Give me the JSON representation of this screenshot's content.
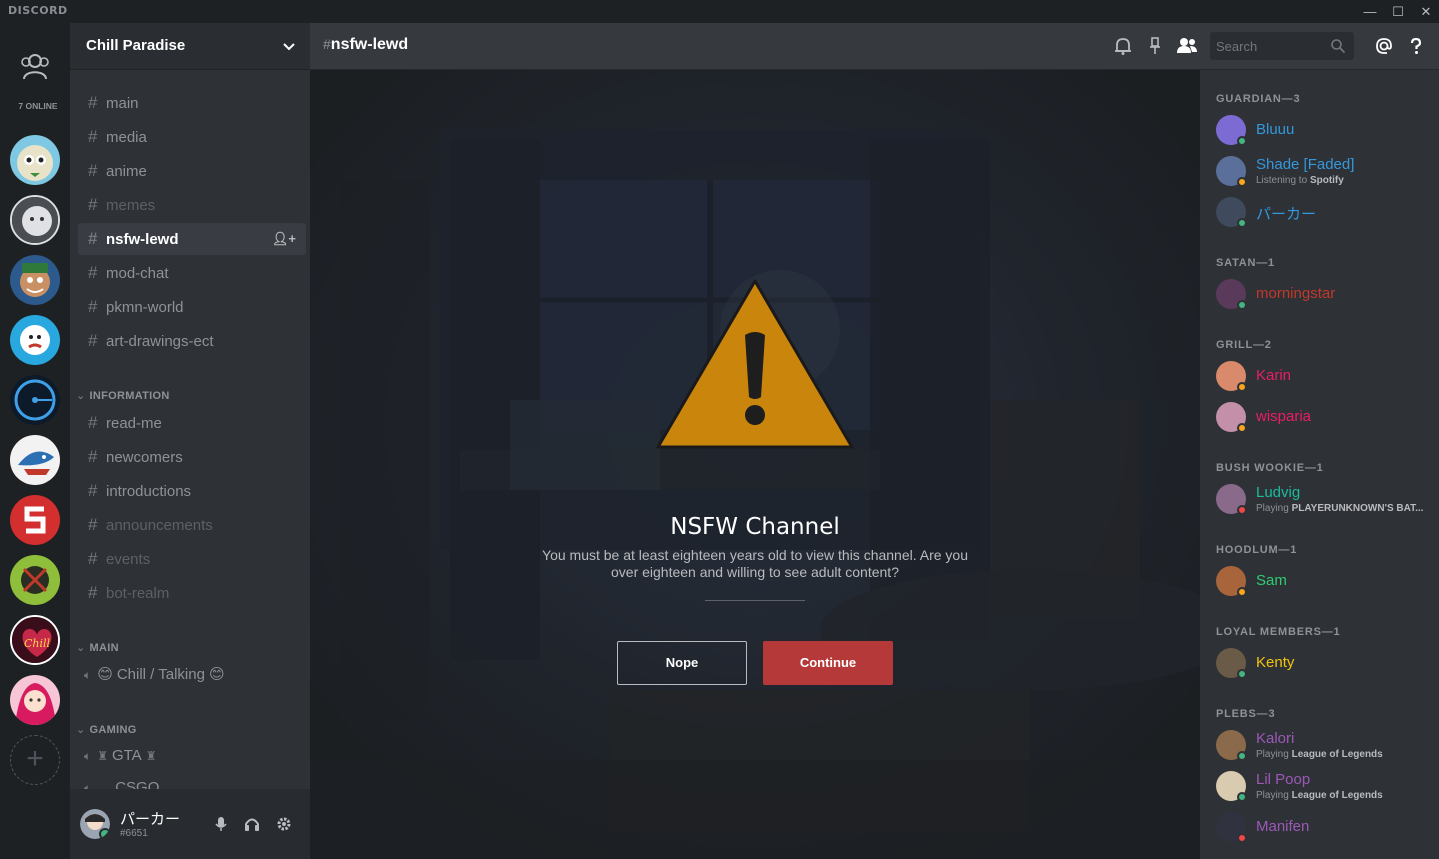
{
  "app": {
    "logo": "DISCORD",
    "window_controls": [
      "—",
      "☐",
      "✕"
    ]
  },
  "guild_rail": {
    "online_count": "7 ONLINE",
    "add_label": "+"
  },
  "sidebar": {
    "server_name": "Chill Paradise",
    "channels_top": [
      {
        "name": "main",
        "state": "normal"
      },
      {
        "name": "media",
        "state": "normal"
      },
      {
        "name": "anime",
        "state": "normal"
      },
      {
        "name": "memes",
        "state": "dim"
      },
      {
        "name": "nsfw-lewd",
        "state": "active"
      },
      {
        "name": "mod-chat",
        "state": "normal"
      },
      {
        "name": "pkmn-world",
        "state": "normal"
      },
      {
        "name": "art-drawings-ect",
        "state": "normal"
      }
    ],
    "category_information": "INFORMATION",
    "channels_info": [
      {
        "name": "read-me",
        "state": "normal"
      },
      {
        "name": "newcomers",
        "state": "normal"
      },
      {
        "name": "introductions",
        "state": "normal"
      },
      {
        "name": "announcements",
        "state": "dim"
      },
      {
        "name": "events",
        "state": "dim"
      },
      {
        "name": "bot-realm",
        "state": "dim"
      }
    ],
    "category_main": "MAIN",
    "voice_main": "Chill / Talking",
    "category_gaming": "GAMING",
    "voice_gaming": "GTA",
    "voice_gaming_cut": "CSGO",
    "user": {
      "name": "パーカー",
      "tag": "#6651"
    }
  },
  "topbar": {
    "channel": "nsfw-lewd",
    "search_placeholder": "Search"
  },
  "gate": {
    "title": "NSFW Channel",
    "description": "You must be at least eighteen years old to view this channel. Are you over eighteen and willing to see adult content?",
    "nope": "Nope",
    "continue": "Continue"
  },
  "members": {
    "categories": [
      {
        "label": "GUARDIAN—3"
      },
      {
        "label": "SATAN—1"
      },
      {
        "label": "GRILL—2"
      },
      {
        "label": "BUSH WOOKIE—1"
      },
      {
        "label": "HOODLUM—1"
      },
      {
        "label": "LOYAL MEMBERS—1"
      },
      {
        "label": "PLEBS—3"
      }
    ],
    "list": [
      {
        "name": "Bluuu",
        "color": "#3498db",
        "status": "online",
        "activity_prefix": "",
        "activity": ""
      },
      {
        "name": "Shade [Faded]",
        "color": "#3498db",
        "status": "idle",
        "activity_prefix": "Listening to",
        "activity": "Spotify"
      },
      {
        "name": "パーカー",
        "color": "#3498db",
        "status": "online",
        "activity_prefix": "",
        "activity": ""
      },
      {
        "name": "morningstar",
        "color": "#c0392b",
        "status": "online",
        "activity_prefix": "",
        "activity": ""
      },
      {
        "name": "Karin",
        "color": "#e91e63",
        "status": "idle",
        "activity_prefix": "",
        "activity": ""
      },
      {
        "name": "wisparia",
        "color": "#e91e63",
        "status": "idle",
        "activity_prefix": "",
        "activity": ""
      },
      {
        "name": "Ludvig",
        "color": "#1abc9c",
        "status": "dnd",
        "activity_prefix": "Playing",
        "activity": "PLAYERUNKNOWN'S BAT..."
      },
      {
        "name": "Sam",
        "color": "#2ecc71",
        "status": "idle",
        "activity_prefix": "",
        "activity": ""
      },
      {
        "name": "Kenty",
        "color": "#f1c40f",
        "status": "online",
        "activity_prefix": "",
        "activity": ""
      },
      {
        "name": "Kalori",
        "color": "#9b59b6",
        "status": "online",
        "activity_prefix": "Playing",
        "activity": "League of Legends"
      },
      {
        "name": "Lil Poop",
        "color": "#9b59b6",
        "status": "online",
        "activity_prefix": "Playing",
        "activity": "League of Legends"
      },
      {
        "name": "Manifen",
        "color": "#9b59b6",
        "status": "dnd",
        "activity_prefix": "",
        "activity": ""
      }
    ]
  }
}
